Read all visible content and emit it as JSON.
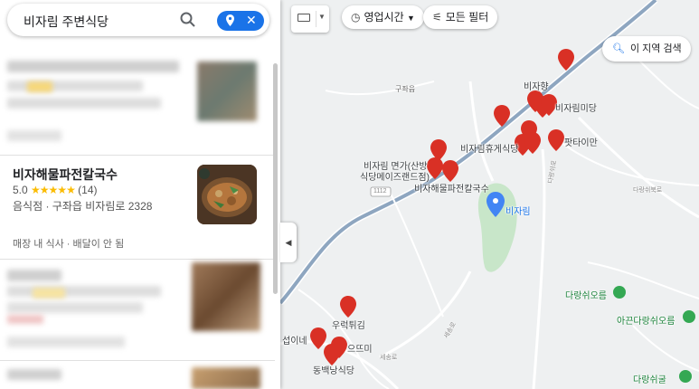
{
  "search": {
    "query": "비자림 주변식당",
    "search_icon": "search-icon",
    "location_icon": "pin-icon",
    "clear_icon": "close-icon"
  },
  "result": {
    "name": "비자해물파전칼국수",
    "rating": "5.0",
    "stars": "★★★★★",
    "review_count": "(14)",
    "category_address": "음식점 · 구좌읍 비자림로 2328",
    "services": "매장 내 식사 · 배달이 안 됨"
  },
  "map_controls": {
    "hours_chip": "영업시간",
    "filter_chip": "모든 필터",
    "search_area": "이 지역 검색",
    "keyboard_icon": "keyboard-icon"
  },
  "map_labels": {
    "gujwa": "구좌읍",
    "bijahyang": "비자향",
    "bijarimdang": "비자림미당",
    "rest_area": "비자림휴게식당",
    "thai": "팟타이만",
    "noodle_line1": "비자림 면가(산방",
    "noodle_line2": "식당메이즈랜드점)",
    "haemul": "비자해물파전칼국수",
    "bijarim": "비자림",
    "road_1112": "1112",
    "darangshi": "다랑쉬오름",
    "ako_darangshi": "아끈다랑쉬오름",
    "darangshi_cave": "다랑쉬굴",
    "urak": "우럭튀김",
    "eutteumi": "으뜨미",
    "dongbaek": "동백낭식당",
    "seopine": "섭이네",
    "road_small1": "세송로",
    "road_small2": "세송로",
    "road_small3": "다랑쉬북로",
    "road_small4": "다랑쉬로"
  },
  "colors": {
    "accent": "#1a73e8",
    "pin_red": "#d93025",
    "star": "#fbbc04",
    "park_green": "#c8e6c9"
  }
}
